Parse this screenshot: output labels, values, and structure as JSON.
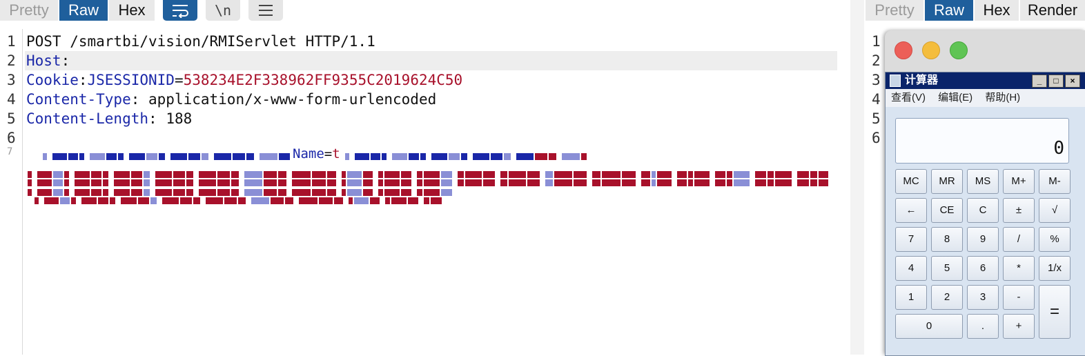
{
  "left_tabs": {
    "pretty": "Pretty",
    "raw": "Raw",
    "hex": "Hex"
  },
  "toolbar": {
    "wrap_icon": "wrap-lines-icon",
    "newline": "\\n",
    "menu_icon": "hamburger-menu-icon"
  },
  "right_tabs": {
    "pretty": "Pretty",
    "raw": "Raw",
    "hex": "Hex",
    "render": "Render"
  },
  "request": {
    "line_numbers": [
      "1",
      "2",
      "3",
      "4",
      "5",
      "6",
      "7"
    ],
    "request_line": "POST /smartbi/vision/RMIServlet HTTP/1.1",
    "host_name": "Host",
    "cookie_name": "Cookie",
    "cookie_key": "JSESSIONID",
    "cookie_value": "538234E2F338962FF9355C2019624C50",
    "content_type_name": "Content-Type",
    "content_type_value": "application/x-www-form-urlencoded",
    "content_length_name": "Content-Length",
    "content_length_value": "188",
    "body_partial_name": "Name",
    "body_partial_value": "t"
  },
  "response": {
    "line_numbers": [
      "1",
      "2",
      "3",
      "4",
      "5",
      "6"
    ]
  },
  "calculator": {
    "title": "计算器",
    "menu": [
      "查看(V)",
      "编辑(E)",
      "帮助(H)"
    ],
    "display": "0",
    "keys": [
      [
        "MC",
        "MR",
        "MS",
        "M+",
        "M-"
      ],
      [
        "←",
        "CE",
        "C",
        "±",
        "√"
      ],
      [
        "7",
        "8",
        "9",
        "/",
        "%"
      ],
      [
        "4",
        "5",
        "6",
        "*",
        "1/x"
      ],
      [
        "1",
        "2",
        "3",
        "-",
        "="
      ],
      [
        "0",
        ".",
        "+"
      ]
    ]
  },
  "colors": {
    "accent": "#1f5f9c",
    "header_name": "#1a27a8",
    "header_value": "#a8112b"
  }
}
